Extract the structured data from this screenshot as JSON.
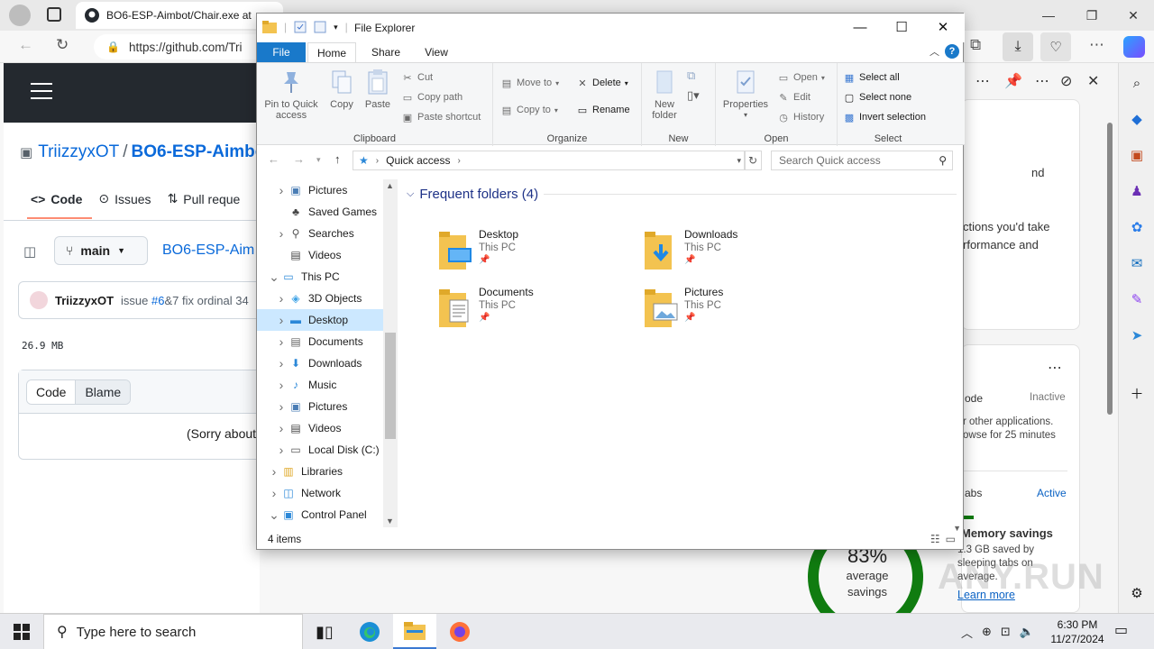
{
  "browser": {
    "tab_title": "BO6-ESP-Aimbot/Chair.exe at",
    "url": "https://github.com/Tri",
    "colors": {
      "gh_header": "#24292f",
      "gh_link": "#0969da"
    }
  },
  "github": {
    "owner": "TriizzyxOT",
    "separator": "/",
    "repo": "BO6-ESP-Aimbo",
    "tabs": [
      {
        "label": "Code",
        "icon": "code-icon"
      },
      {
        "label": "Issues",
        "icon": "issue-icon"
      },
      {
        "label": "Pull reque",
        "icon": "pull-request-icon"
      }
    ],
    "branch": "main",
    "file_crumb": "BO6-ESP-Aim",
    "commit_author": "TriizzyxOT",
    "commit_message_prefix": "issue ",
    "commit_issue": "#6",
    "commit_message_suffix": "&7 fix ordinal 34",
    "file_size": "26.9 MB",
    "view_tabs": [
      "Code",
      "Blame"
    ],
    "sorry_text": "(Sorry about"
  },
  "explorer": {
    "title": "File Explorer",
    "ribbon_tabs": [
      "File",
      "Home",
      "Share",
      "View"
    ],
    "clipboard": {
      "label": "Clipboard",
      "pin": "Pin to Quick access",
      "copy": "Copy",
      "paste": "Paste",
      "cut": "Cut",
      "copy_path": "Copy path",
      "paste_shortcut": "Paste shortcut"
    },
    "organize": {
      "label": "Organize",
      "move_to": "Move to",
      "copy_to": "Copy to",
      "delete": "Delete",
      "rename": "Rename"
    },
    "new": {
      "label": "New",
      "new_folder": "New folder"
    },
    "open": {
      "label": "Open",
      "properties": "Properties",
      "open": "Open",
      "edit": "Edit",
      "history": "History"
    },
    "select": {
      "label": "Select",
      "select_all": "Select all",
      "select_none": "Select none",
      "invert": "Invert selection"
    },
    "address": "Quick access",
    "search_placeholder": "Search Quick access",
    "nav_items": [
      {
        "label": "Pictures",
        "icon": "pictures-icon",
        "expand": ">",
        "indent": 1
      },
      {
        "label": "Saved Games",
        "icon": "saved-games-icon",
        "expand": "",
        "indent": 1
      },
      {
        "label": "Searches",
        "icon": "search-icon",
        "expand": ">",
        "indent": 1
      },
      {
        "label": "Videos",
        "icon": "videos-icon",
        "expand": "",
        "indent": 1
      },
      {
        "label": "This PC",
        "icon": "computer-icon",
        "expand": "v",
        "indent": 0
      },
      {
        "label": "3D Objects",
        "icon": "3d-objects-icon",
        "expand": ">",
        "indent": 1
      },
      {
        "label": "Desktop",
        "icon": "desktop-icon",
        "expand": ">",
        "indent": 1
      },
      {
        "label": "Documents",
        "icon": "documents-icon",
        "expand": ">",
        "indent": 1
      },
      {
        "label": "Downloads",
        "icon": "downloads-icon",
        "expand": ">",
        "indent": 1
      },
      {
        "label": "Music",
        "icon": "music-icon",
        "expand": ">",
        "indent": 1
      },
      {
        "label": "Pictures",
        "icon": "pictures-icon",
        "expand": ">",
        "indent": 1
      },
      {
        "label": "Videos",
        "icon": "videos-icon",
        "expand": ">",
        "indent": 1
      },
      {
        "label": "Local Disk (C:)",
        "icon": "disk-icon",
        "expand": ">",
        "indent": 1
      },
      {
        "label": "Libraries",
        "icon": "libraries-icon",
        "expand": ">",
        "indent": 0
      },
      {
        "label": "Network",
        "icon": "network-icon",
        "expand": ">",
        "indent": 0
      },
      {
        "label": "Control Panel",
        "icon": "control-panel-icon",
        "expand": "v",
        "indent": 0
      }
    ],
    "group_title": "Frequent folders (4)",
    "folders": [
      {
        "name": "Desktop",
        "location": "This PC",
        "badge": "desktop"
      },
      {
        "name": "Downloads",
        "location": "This PC",
        "badge": "downloads"
      },
      {
        "name": "Documents",
        "location": "This PC",
        "badge": "documents"
      },
      {
        "name": "Pictures",
        "location": "This PC",
        "badge": "pictures"
      }
    ],
    "status_count": "4 items"
  },
  "edge_panel": {
    "text_line1": "nd",
    "text_line2": "ctions you'd take",
    "text_line3": "rformance and",
    "row1_label": "ode",
    "row1_status": "Inactive",
    "row1_desc1": "r other applications.",
    "row1_desc2": "owse for 25 minutes",
    "row2_label": "abs",
    "row2_status": "Active",
    "memory_title": "Memory savings",
    "memory_desc1": "1.3 GB saved by",
    "memory_desc2": "sleeping tabs on",
    "memory_desc3": "average.",
    "learn_more": "Learn more",
    "savings_pct": "83%",
    "savings_label1": "average",
    "savings_label2": "savings",
    "savings_fraction": 0.83
  },
  "watermark": "ANY.RUN",
  "taskbar": {
    "search_placeholder": "Type here to search",
    "time": "6:30 PM",
    "date": "11/27/2024"
  }
}
